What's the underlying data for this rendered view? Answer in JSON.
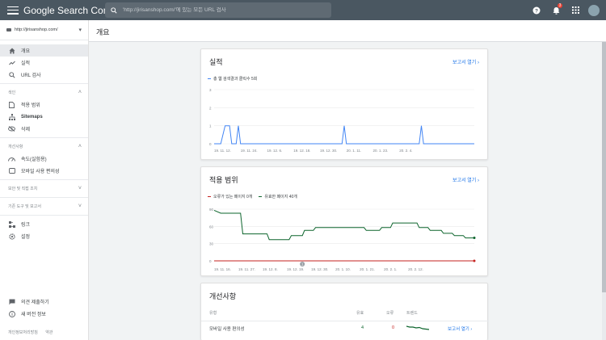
{
  "topbar": {
    "app_title": "Google Search Console",
    "search_placeholder": "'http://jirisanshop.com/'에 있는 모든 URL 검사",
    "notification_count": "3",
    "icons": {
      "menu": "hamburger-icon",
      "search": "search-icon",
      "help": "help-icon",
      "notifications": "bell-icon",
      "apps": "apps-grid-icon"
    }
  },
  "sidebar": {
    "property": "http://jirisanshop.com/",
    "top_items": [
      {
        "label": "개요",
        "icon": "home-icon",
        "active": true
      },
      {
        "label": "실적",
        "icon": "trending-icon"
      },
      {
        "label": "URL 검사",
        "icon": "search-icon"
      }
    ],
    "index_section": "색인",
    "index_items": [
      {
        "label": "적용 범위",
        "icon": "file-icon"
      },
      {
        "label": "Sitemaps",
        "icon": "sitemap-icon"
      },
      {
        "label": "삭제",
        "icon": "eye-off-icon"
      }
    ],
    "enhance_section": "개선사항",
    "enhance_items": [
      {
        "label": "속도(실험용)",
        "icon": "speed-icon"
      },
      {
        "label": "모바일 사용 편의성",
        "icon": "phone-icon"
      }
    ],
    "security_section": "보안 및 직접 조치",
    "legacy_section": "기존 도구 및 보고서",
    "other_items": [
      {
        "label": "링크",
        "icon": "links-icon"
      },
      {
        "label": "설정",
        "icon": "settings-icon"
      }
    ],
    "bottom_items": [
      {
        "label": "의견 제출하기",
        "icon": "feedback-icon"
      },
      {
        "label": "새 버전 정보",
        "icon": "info-icon"
      }
    ],
    "footer": {
      "privacy": "개인정보처리방침",
      "terms": "약관"
    }
  },
  "header": {
    "title": "개요"
  },
  "cards": {
    "performance": {
      "title": "실적",
      "report_link": "보고서 열기",
      "legend": "총 웹 검색결과 클릭수 5회"
    },
    "coverage": {
      "title": "적용 범위",
      "report_link": "보고서 열기",
      "legend_error": "오류가 있는 페이지 0개",
      "legend_valid": "유효한 페이지 40개",
      "marker": "1"
    },
    "enhancements": {
      "title": "개선사항",
      "columns": {
        "type": "유형",
        "valid": "유효",
        "error": "오류",
        "trend": "트렌드"
      },
      "rows": [
        {
          "type": "모바일 사용 편의성",
          "valid": "4",
          "error": "0",
          "report_link": "보고서 열기"
        }
      ]
    }
  },
  "colors": {
    "topbar": "#4a5761",
    "link": "#1a73e8",
    "clicks": "#4285f4",
    "valid": "#0d652d",
    "error": "#c5221f"
  },
  "chart_data": [
    {
      "type": "line",
      "series": [
        {
          "name": "총 웹 검색결과 클릭수 5회",
          "color": "#4285f4",
          "points": [
            [
              0,
              0
            ],
            [
              3,
              0
            ],
            [
              5,
              1
            ],
            [
              7,
              1
            ],
            [
              8,
              0
            ],
            [
              10,
              0
            ],
            [
              11,
              1
            ],
            [
              12,
              0
            ],
            [
              58,
              0
            ],
            [
              59,
              1
            ],
            [
              60,
              0
            ],
            [
              93,
              0
            ],
            [
              94,
              1
            ],
            [
              95,
              0
            ],
            [
              118,
              0
            ]
          ]
        }
      ],
      "x_range": [
        0,
        118
      ],
      "ylim": [
        0,
        3
      ],
      "yticks": [
        "0",
        "1",
        "2",
        "3"
      ],
      "xticks": [
        {
          "label": "19. 11. 12.",
          "x": 0
        },
        {
          "label": "19. 11. 24.",
          "x": 12
        },
        {
          "label": "19. 12. 6.",
          "x": 24
        },
        {
          "label": "19. 12. 18.",
          "x": 36
        },
        {
          "label": "19. 12. 30.",
          "x": 48
        },
        {
          "label": "20. 1. 11.",
          "x": 60
        },
        {
          "label": "20. 1. 23.",
          "x": 72
        },
        {
          "label": "20. 2. 4.",
          "x": 84
        }
      ]
    },
    {
      "type": "line",
      "series": [
        {
          "name": "유효한 페이지 40개",
          "color": "#0d652d",
          "points": [
            [
              0,
              88
            ],
            [
              3,
              83
            ],
            [
              12,
              83
            ],
            [
              13,
              47
            ],
            [
              24,
              47
            ],
            [
              25,
              37
            ],
            [
              34,
              37
            ],
            [
              35,
              44
            ],
            [
              40,
              44
            ],
            [
              41,
              53
            ],
            [
              45,
              53
            ],
            [
              46,
              58
            ],
            [
              68,
              58
            ],
            [
              69,
              53
            ],
            [
              75,
              53
            ],
            [
              76,
              58
            ],
            [
              80,
              58
            ],
            [
              81,
              66
            ],
            [
              92,
              66
            ],
            [
              93,
              58
            ],
            [
              97,
              58
            ],
            [
              98,
              53
            ],
            [
              103,
              53
            ],
            [
              104,
              48
            ],
            [
              108,
              48
            ],
            [
              109,
              44
            ],
            [
              113,
              44
            ],
            [
              114,
              40
            ],
            [
              118,
              40
            ]
          ]
        },
        {
          "name": "오류가 있는 페이지 0개",
          "color": "#c5221f",
          "points": [
            [
              0,
              0
            ],
            [
              118,
              0
            ]
          ]
        }
      ],
      "x_range": [
        0,
        118
      ],
      "ylim": [
        0,
        90
      ],
      "yticks": [
        "0",
        "30",
        "60",
        "90"
      ],
      "xticks": [
        {
          "label": "19. 11. 16.",
          "x": 0
        },
        {
          "label": "19. 11. 27.",
          "x": 11
        },
        {
          "label": "19. 12. 8.",
          "x": 22
        },
        {
          "label": "19. 12. 19.",
          "x": 33
        },
        {
          "label": "19. 12. 30.",
          "x": 44
        },
        {
          "label": "20. 1. 10.",
          "x": 55
        },
        {
          "label": "20. 1. 21.",
          "x": 66
        },
        {
          "label": "20. 2. 1.",
          "x": 77
        },
        {
          "label": "20. 2. 12.",
          "x": 88
        }
      ]
    }
  ]
}
